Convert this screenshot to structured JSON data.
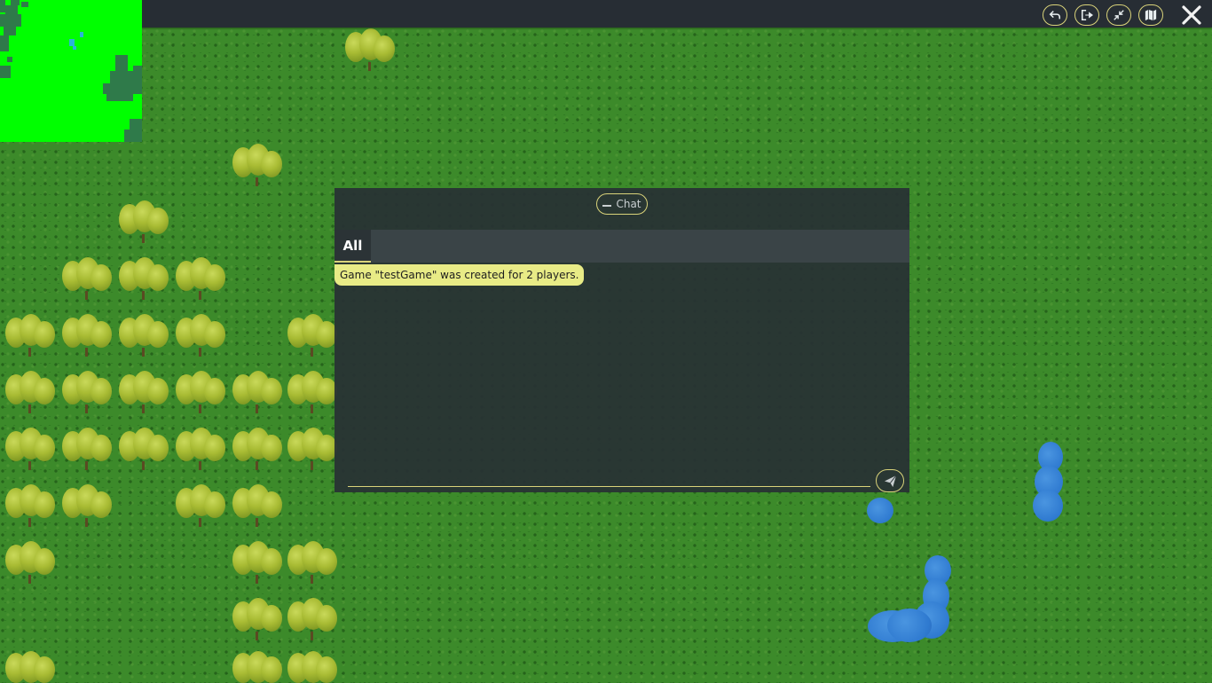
{
  "toolbar": {
    "buttons": [
      {
        "icon": "undo-icon"
      },
      {
        "icon": "exit-icon"
      },
      {
        "icon": "minimize-icon"
      },
      {
        "icon": "map-icon"
      }
    ],
    "close_icon": "close-icon",
    "accent_color": "#d9d37a"
  },
  "minimap": {
    "background_color": "#00ff00",
    "forest_color": "#2f7a4a",
    "water_color": "#2ab6d8"
  },
  "chat": {
    "title": "Chat",
    "tabs": [
      {
        "label": "All"
      }
    ],
    "messages": [
      {
        "text": "Game \"testGame\" was created for 2 players."
      }
    ],
    "input_value": "",
    "input_placeholder": ""
  },
  "map": {
    "grass_color": "#3c8a2a",
    "tree_color": "#a8bb33",
    "water_color": "#2f7ad0"
  }
}
